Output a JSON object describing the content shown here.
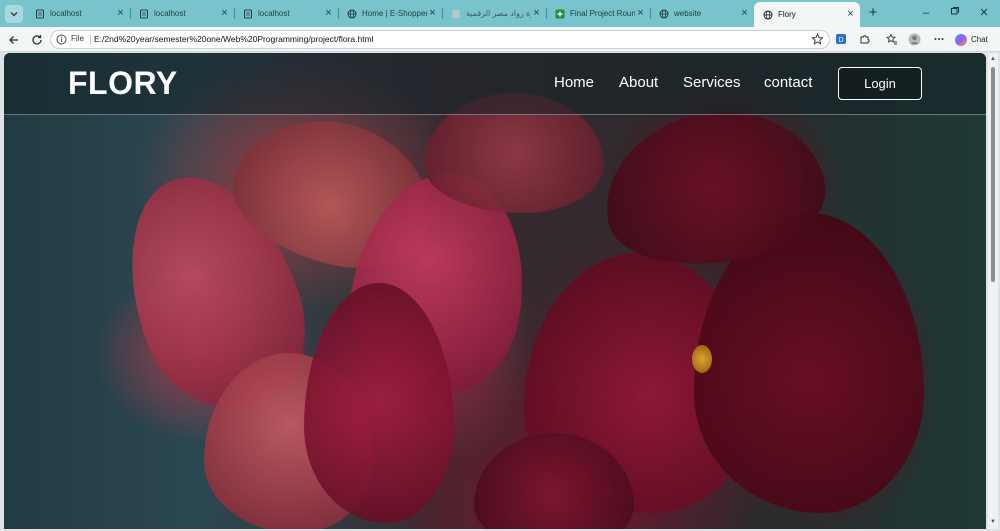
{
  "browser": {
    "tabs": [
      {
        "title": "localhost",
        "icon": "page-icon"
      },
      {
        "title": "localhost",
        "icon": "page-icon"
      },
      {
        "title": "localhost",
        "icon": "page-icon"
      },
      {
        "title": "Home | E-Shopper",
        "icon": "globe-icon"
      },
      {
        "title": "مبادرة رواد مصر الرقمية",
        "icon": "sheet-icon"
      },
      {
        "title": "Final Project Round",
        "icon": "plus-sheet-icon"
      },
      {
        "title": "website",
        "icon": "globe-icon"
      },
      {
        "title": "Flory",
        "icon": "globe-icon",
        "active": true
      }
    ],
    "address": {
      "scheme_label": "File",
      "url": "E:/2nd%20year/semester%20one/Web%20Programming/project/flora.html"
    },
    "chat_label": "Chat",
    "accent_color": "#79c4cc"
  },
  "page": {
    "logo": "FLORY",
    "nav": [
      {
        "label": "Home"
      },
      {
        "label": "About"
      },
      {
        "label": "Services"
      },
      {
        "label": "contact"
      }
    ],
    "login_label": "Login"
  }
}
